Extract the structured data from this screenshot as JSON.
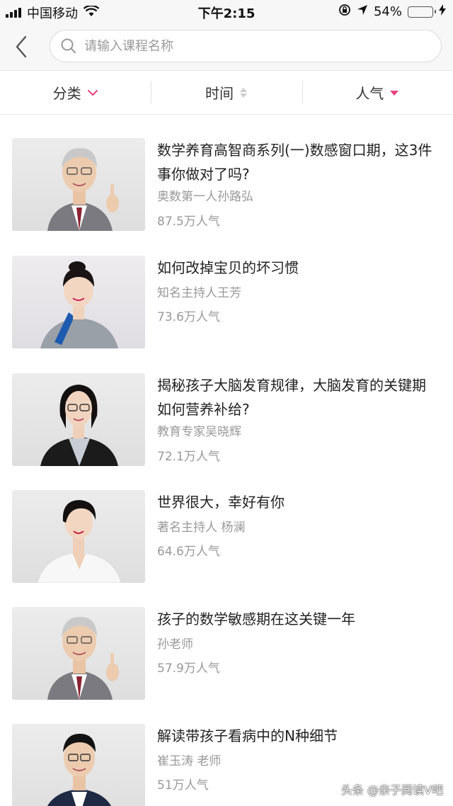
{
  "status_bar": {
    "carrier": "中国移动",
    "time": "下午2:15",
    "battery": "54%",
    "battery_level": 0.54
  },
  "search": {
    "placeholder": "请输入课程名称"
  },
  "filters": [
    {
      "label": "分类",
      "icon": "chevron-down-icon"
    },
    {
      "label": "时间",
      "icon": "sort-icon"
    },
    {
      "label": "人气",
      "icon": "caret-down-icon"
    }
  ],
  "colors": {
    "accent": "#e9407f",
    "text_primary": "#222222",
    "text_secondary": "#999999"
  },
  "courses": [
    {
      "title": "数学养育高智商系列(一)数感窗口期，这3件事你做对了吗?",
      "author": "奥数第一人孙路弘",
      "popularity": "87.5万人气",
      "image": "portrait-man-gray-hair"
    },
    {
      "title": "如何改掉宝贝的坏习惯",
      "author": "知名主持人王芳",
      "popularity": "73.6万人气",
      "image": "portrait-woman-blue-scarf"
    },
    {
      "title": "揭秘孩子大脑发育规律，大脑发育的关键期如何营养补给?",
      "author": "教育专家吴晓辉",
      "popularity": "72.1万人气",
      "image": "portrait-woman-glasses"
    },
    {
      "title": "世界很大，幸好有你",
      "author": "著名主持人 杨澜",
      "popularity": "64.6万人气",
      "image": "portrait-woman-white-shirt"
    },
    {
      "title": "孩子的数学敏感期在这关键一年",
      "author": "孙老师",
      "popularity": "57.9万人气",
      "image": "portrait-man-gray-hair"
    },
    {
      "title": "解读带孩子看病中的N种细节",
      "author": "崔玉涛 老师",
      "popularity": "51万人气",
      "image": "portrait-man-glasses"
    }
  ],
  "watermark": "头条 @亲子阅读V吧"
}
